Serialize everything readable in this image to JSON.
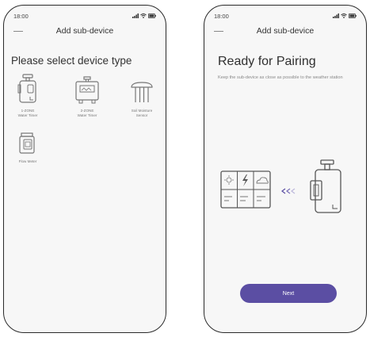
{
  "left_screen": {
    "status": {
      "time": "18:00"
    },
    "header": {
      "title": "Add sub-device"
    },
    "section_title": "Please select device type",
    "devices": [
      {
        "label": "1-ZONE\nWater Timer",
        "icon": "water-timer-1zone-icon"
      },
      {
        "label": "2-ZONE\nWater Timer",
        "icon": "water-timer-2zone-icon"
      },
      {
        "label": "Soil Moisture\nSensor",
        "icon": "soil-moisture-sensor-icon"
      },
      {
        "label": "Flow Meter",
        "icon": "flow-meter-icon"
      }
    ]
  },
  "right_screen": {
    "status": {
      "time": "18:00"
    },
    "header": {
      "title": "Add sub-device"
    },
    "pairing_title": "Ready for Pairing",
    "pairing_description": "Keep the sub-device as close as possible to the weather station",
    "next_label": "Next",
    "colors": {
      "primary_button": "#5b4ea3"
    }
  }
}
